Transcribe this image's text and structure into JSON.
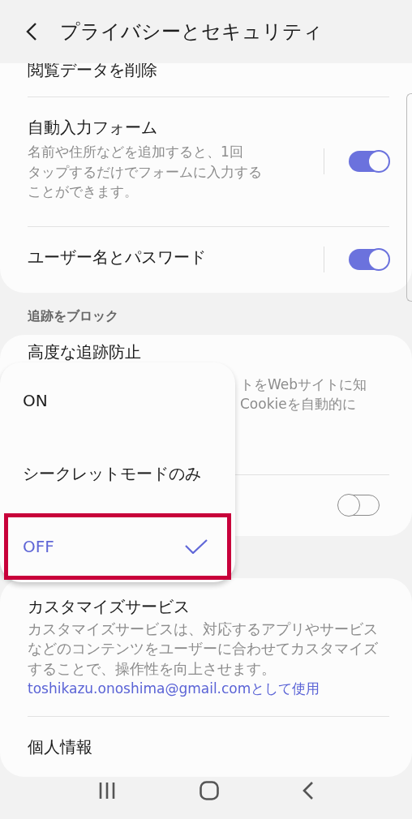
{
  "header": {
    "title": "プライバシーとセキュリティ"
  },
  "cards": [
    {
      "rows": [
        {
          "kind": "plain",
          "title": "閲覧データを削除"
        },
        {
          "kind": "toggle",
          "title": "自動入力フォーム",
          "lines": [
            "名前や住所などを追加すると、1回",
            "タップするだけでフォームに入力する",
            "ことができます。"
          ],
          "on": true
        },
        {
          "kind": "toggle",
          "title": "ユーザー名とパスワード",
          "on": true
        }
      ]
    },
    {
      "label": "追跡をブロック",
      "rows": [
        {
          "kind": "covered",
          "title": "高度な追跡防止",
          "lines": [
            "トをWebサイトに知",
            "Cookieを自動的に"
          ]
        },
        {
          "kind": "toggle",
          "on": false
        }
      ]
    },
    {
      "rows": [
        {
          "kind": "account",
          "title": "カスタマイズサービス",
          "lines": [
            "カスタマイズサービスは、対応するアプリやサービス",
            "などのコンテンツをユーザーに合わせてカスタマイズ",
            "することで、操作性を向上させます。"
          ],
          "link": "toshikazu.onoshima@gmail.comとして使用"
        },
        {
          "kind": "plain",
          "title": "個人情報"
        }
      ]
    }
  ],
  "popup": {
    "options": [
      {
        "label": "ON",
        "selected": false,
        "highlighted": false
      },
      {
        "label": "シークレットモードのみ",
        "selected": false,
        "highlighted": false
      },
      {
        "label": "OFF",
        "selected": true,
        "highlighted": true
      }
    ]
  }
}
